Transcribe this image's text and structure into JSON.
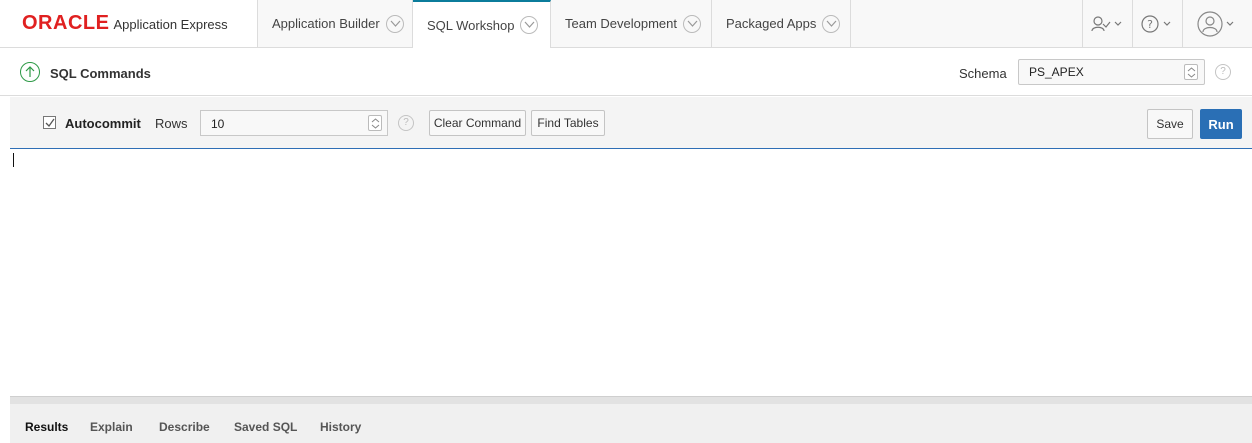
{
  "header": {
    "logo": {
      "brand": "ORACLE",
      "product": "Application Express"
    },
    "tabs": [
      {
        "label": "Application Builder",
        "active": false
      },
      {
        "label": "SQL Workshop",
        "active": true
      },
      {
        "label": "Team Development",
        "active": false
      },
      {
        "label": "Packaged Apps",
        "active": false
      }
    ],
    "icons": [
      "user-admin-icon",
      "help-icon",
      "user-profile-icon"
    ]
  },
  "page": {
    "title": "SQL Commands",
    "schema_label": "Schema",
    "schema_value": "PS_APEX"
  },
  "toolbar": {
    "autocommit_label": "Autocommit",
    "autocommit_checked": true,
    "rows_label": "Rows",
    "rows_value": "10",
    "clear_command": "Clear Command",
    "find_tables": "Find Tables",
    "save": "Save",
    "run": "Run"
  },
  "editor": {
    "content": ""
  },
  "results_tabs": [
    {
      "label": "Results",
      "active": true
    },
    {
      "label": "Explain",
      "active": false
    },
    {
      "label": "Describe",
      "active": false
    },
    {
      "label": "Saved SQL",
      "active": false
    },
    {
      "label": "History",
      "active": false
    }
  ],
  "colors": {
    "accent": "#2a6fb5",
    "brand": "#e02020",
    "active_tab_border": "#0b7c9b",
    "up_icon": "#2e9a47"
  }
}
